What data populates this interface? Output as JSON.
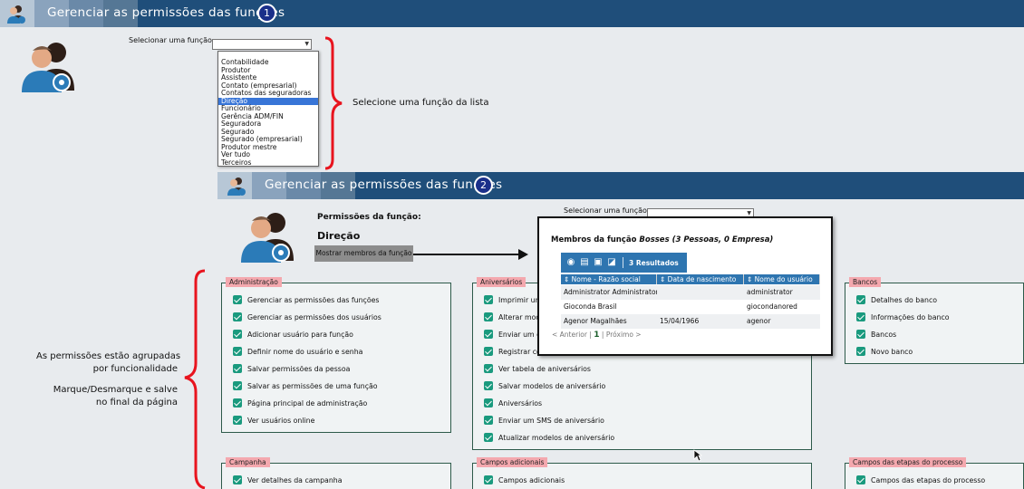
{
  "header1": {
    "title": "Gerenciar as permissões das funções",
    "step": "1"
  },
  "header2": {
    "title": "Gerenciar as permissões das funções",
    "step": "2"
  },
  "selector1": {
    "label": "Selecionar uma função"
  },
  "selector2": {
    "label": "Selecionar uma função"
  },
  "dropdown_options": [
    "Contabilidade",
    "Produtor",
    "Assistente",
    "Contato (empresarial)",
    "Contatos das seguradoras",
    "Direção",
    "Funcionário",
    "Gerência ADM/FIN",
    "Seguradora",
    "Segurado",
    "Segurado (empresarial)",
    "Produtor mestre",
    "Ver tudo",
    "Terceiros"
  ],
  "dropdown_selected": "Direção",
  "annotations": {
    "select_hint": "Selecione uma função da lista",
    "grouped_line1": "As permissões estão agrupadas",
    "grouped_line2": "por funcionalidade",
    "toggle_line1": "Marque/Desmarque e salve",
    "toggle_line2": "no final da página"
  },
  "permissions": {
    "title": "Permissões da função:",
    "role": "Direção",
    "members_button": "Mostrar membros da função"
  },
  "groups": {
    "administracao": {
      "label": "Administração",
      "items": [
        "Gerenciar as permissões das funções",
        "Gerenciar as permissões dos usuários",
        "Adicionar usuário para função",
        "Definir nome do usuário e senha",
        "Salvar permissões da pessoa",
        "Salvar as permissões de uma função",
        "Página principal de administração",
        "Ver usuários online"
      ]
    },
    "aniversarios": {
      "label": "Aniversários",
      "items": [
        "Imprimir um",
        "Alterar modelo",
        "Enviar um e-",
        "Registrar co",
        "Ver tabela de aniversários",
        "Salvar modelos de aniversário",
        "Aniversários",
        "Enviar um SMS de aniversário",
        "Atualizar modelos de aniversário"
      ]
    },
    "bancos": {
      "label": "Bancos",
      "items": [
        "Detalhes do banco",
        "Informações do banco",
        "Bancos",
        "Novo banco"
      ]
    },
    "campanha": {
      "label": "Campanha",
      "items": [
        "Ver detalhes da campanha"
      ]
    },
    "campos_adicionais": {
      "label": "Campos adicionais",
      "items": [
        "Campos adicionais"
      ]
    },
    "campos_etapas": {
      "label": "Campos das etapas do processo",
      "items": [
        "Campos das etapas do processo"
      ]
    }
  },
  "popup": {
    "title_prefix": "Membros da função ",
    "title_role": "Bosses (3 Pessoas, 0 Empresa)",
    "results": "3 Resultados",
    "columns": [
      "Nome - Razão social",
      "Data de nascimento",
      "Nome do usuário"
    ],
    "rows": [
      [
        "Administrator Administrator",
        "",
        "administrator"
      ],
      [
        "Gioconda Brasil",
        "",
        "giocondanored"
      ],
      [
        "Agenor Magalhães",
        "15/04/1966",
        "agenor"
      ]
    ],
    "pager_prev": "< Anterior",
    "pager_sep": "|",
    "pager_current": "1",
    "pager_next": "Próximo >"
  },
  "colors": {
    "header_bg": "#1f4e7a",
    "accent_red": "#e8141e",
    "check_green": "#1a9a7e",
    "group_label_bg": "#f4a8ae",
    "table_blue": "#2e75b0"
  }
}
